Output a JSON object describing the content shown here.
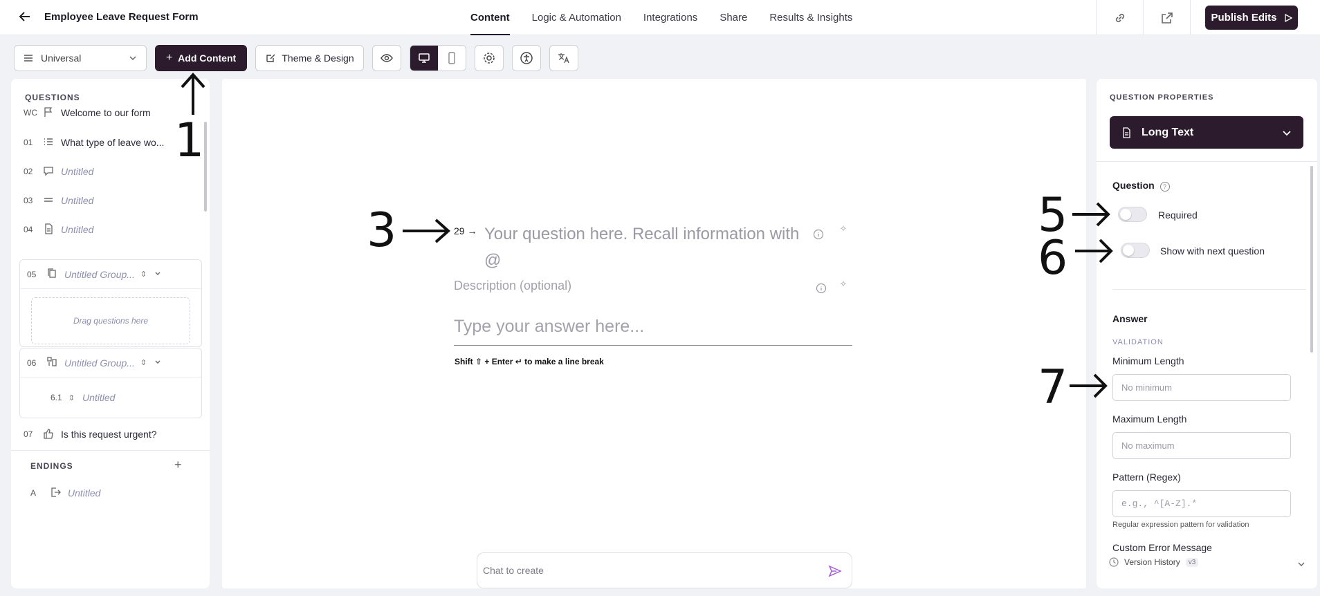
{
  "header": {
    "title": "Employee Leave Request Form",
    "tabs": [
      {
        "label": "Content",
        "active": true
      },
      {
        "label": "Logic & Automation",
        "active": false
      },
      {
        "label": "Integrations",
        "active": false
      },
      {
        "label": "Share",
        "active": false
      },
      {
        "label": "Results & Insights",
        "active": false
      }
    ],
    "publish_label": "Publish Edits"
  },
  "toolbar": {
    "universal_label": "Universal",
    "add_content_label": "Add Content",
    "theme_label": "Theme & Design"
  },
  "questions_panel": {
    "heading": "QUESTIONS",
    "items": [
      {
        "num": "WC",
        "icon": "flag-icon",
        "label": "Welcome to our form"
      },
      {
        "num": "01",
        "icon": "list-icon",
        "label": "What type of leave wo..."
      },
      {
        "num": "02",
        "icon": "chat-icon",
        "label": "Untitled"
      },
      {
        "num": "03",
        "icon": "short-text-icon",
        "label": "Untitled"
      },
      {
        "num": "04",
        "icon": "document-icon",
        "label": "Untitled"
      }
    ],
    "group1": {
      "num": "05",
      "label": "Untitled Group...",
      "drag_text": "Drag questions here"
    },
    "group2": {
      "num": "06",
      "label": "Untitled Group...",
      "child_num": "6.1",
      "child_label": "Untitled"
    },
    "item07": {
      "num": "07",
      "label": "Is this request urgent?"
    },
    "endings_heading": "ENDINGS",
    "ending": {
      "num": "A",
      "label": "Untitled"
    }
  },
  "canvas": {
    "question_number": "29",
    "question_placeholder": "Your question here. Recall information with @",
    "description_placeholder": "Description (optional)",
    "answer_placeholder": "Type your answer here...",
    "hint": "Shift ⇧ + Enter ↵ to make a line break",
    "chat_placeholder": "Chat to create"
  },
  "properties": {
    "heading": "QUESTION PROPERTIES",
    "type_label": "Long Text",
    "question_label": "Question",
    "required_label": "Required",
    "show_next_label": "Show with next question",
    "answer_label": "Answer",
    "validation_label": "VALIDATION",
    "min_length_label": "Minimum Length",
    "min_length_placeholder": "No minimum",
    "max_length_label": "Maximum Length",
    "max_length_placeholder": "No maximum",
    "pattern_label": "Pattern (Regex)",
    "pattern_placeholder": "e.g., ^[A-Z].*",
    "pattern_help": "Regular expression pattern for validation",
    "custom_error_label": "Custom Error Message",
    "version_label": "Version History",
    "version_badge": "v3"
  },
  "annotations": [
    "1",
    "3",
    "5",
    "6",
    "7"
  ],
  "colors": {
    "accent": "#2b1b2c",
    "muted_text": "#8d8fb0"
  }
}
